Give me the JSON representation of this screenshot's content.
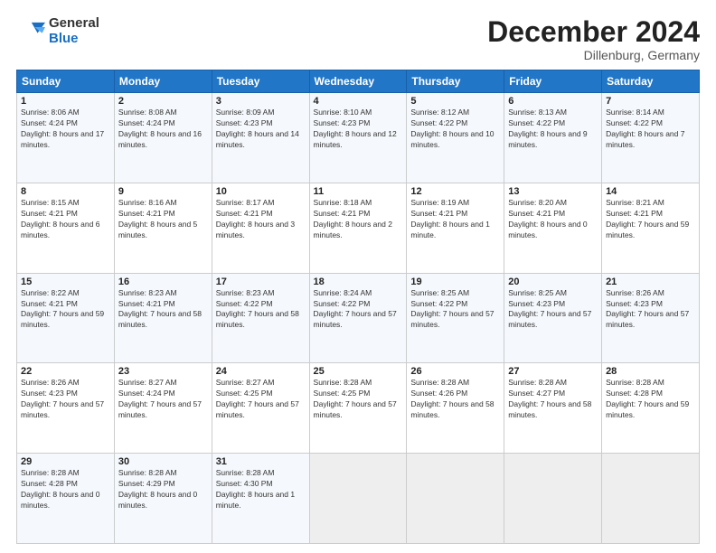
{
  "logo": {
    "general": "General",
    "blue": "Blue"
  },
  "header": {
    "month": "December 2024",
    "location": "Dillenburg, Germany"
  },
  "weekdays": [
    "Sunday",
    "Monday",
    "Tuesday",
    "Wednesday",
    "Thursday",
    "Friday",
    "Saturday"
  ],
  "weeks": [
    [
      {
        "day": "1",
        "sunrise": "Sunrise: 8:06 AM",
        "sunset": "Sunset: 4:24 PM",
        "daylight": "Daylight: 8 hours and 17 minutes."
      },
      {
        "day": "2",
        "sunrise": "Sunrise: 8:08 AM",
        "sunset": "Sunset: 4:24 PM",
        "daylight": "Daylight: 8 hours and 16 minutes."
      },
      {
        "day": "3",
        "sunrise": "Sunrise: 8:09 AM",
        "sunset": "Sunset: 4:23 PM",
        "daylight": "Daylight: 8 hours and 14 minutes."
      },
      {
        "day": "4",
        "sunrise": "Sunrise: 8:10 AM",
        "sunset": "Sunset: 4:23 PM",
        "daylight": "Daylight: 8 hours and 12 minutes."
      },
      {
        "day": "5",
        "sunrise": "Sunrise: 8:12 AM",
        "sunset": "Sunset: 4:22 PM",
        "daylight": "Daylight: 8 hours and 10 minutes."
      },
      {
        "day": "6",
        "sunrise": "Sunrise: 8:13 AM",
        "sunset": "Sunset: 4:22 PM",
        "daylight": "Daylight: 8 hours and 9 minutes."
      },
      {
        "day": "7",
        "sunrise": "Sunrise: 8:14 AM",
        "sunset": "Sunset: 4:22 PM",
        "daylight": "Daylight: 8 hours and 7 minutes."
      }
    ],
    [
      {
        "day": "8",
        "sunrise": "Sunrise: 8:15 AM",
        "sunset": "Sunset: 4:21 PM",
        "daylight": "Daylight: 8 hours and 6 minutes."
      },
      {
        "day": "9",
        "sunrise": "Sunrise: 8:16 AM",
        "sunset": "Sunset: 4:21 PM",
        "daylight": "Daylight: 8 hours and 5 minutes."
      },
      {
        "day": "10",
        "sunrise": "Sunrise: 8:17 AM",
        "sunset": "Sunset: 4:21 PM",
        "daylight": "Daylight: 8 hours and 3 minutes."
      },
      {
        "day": "11",
        "sunrise": "Sunrise: 8:18 AM",
        "sunset": "Sunset: 4:21 PM",
        "daylight": "Daylight: 8 hours and 2 minutes."
      },
      {
        "day": "12",
        "sunrise": "Sunrise: 8:19 AM",
        "sunset": "Sunset: 4:21 PM",
        "daylight": "Daylight: 8 hours and 1 minute."
      },
      {
        "day": "13",
        "sunrise": "Sunrise: 8:20 AM",
        "sunset": "Sunset: 4:21 PM",
        "daylight": "Daylight: 8 hours and 0 minutes."
      },
      {
        "day": "14",
        "sunrise": "Sunrise: 8:21 AM",
        "sunset": "Sunset: 4:21 PM",
        "daylight": "Daylight: 7 hours and 59 minutes."
      }
    ],
    [
      {
        "day": "15",
        "sunrise": "Sunrise: 8:22 AM",
        "sunset": "Sunset: 4:21 PM",
        "daylight": "Daylight: 7 hours and 59 minutes."
      },
      {
        "day": "16",
        "sunrise": "Sunrise: 8:23 AM",
        "sunset": "Sunset: 4:21 PM",
        "daylight": "Daylight: 7 hours and 58 minutes."
      },
      {
        "day": "17",
        "sunrise": "Sunrise: 8:23 AM",
        "sunset": "Sunset: 4:22 PM",
        "daylight": "Daylight: 7 hours and 58 minutes."
      },
      {
        "day": "18",
        "sunrise": "Sunrise: 8:24 AM",
        "sunset": "Sunset: 4:22 PM",
        "daylight": "Daylight: 7 hours and 57 minutes."
      },
      {
        "day": "19",
        "sunrise": "Sunrise: 8:25 AM",
        "sunset": "Sunset: 4:22 PM",
        "daylight": "Daylight: 7 hours and 57 minutes."
      },
      {
        "day": "20",
        "sunrise": "Sunrise: 8:25 AM",
        "sunset": "Sunset: 4:23 PM",
        "daylight": "Daylight: 7 hours and 57 minutes."
      },
      {
        "day": "21",
        "sunrise": "Sunrise: 8:26 AM",
        "sunset": "Sunset: 4:23 PM",
        "daylight": "Daylight: 7 hours and 57 minutes."
      }
    ],
    [
      {
        "day": "22",
        "sunrise": "Sunrise: 8:26 AM",
        "sunset": "Sunset: 4:23 PM",
        "daylight": "Daylight: 7 hours and 57 minutes."
      },
      {
        "day": "23",
        "sunrise": "Sunrise: 8:27 AM",
        "sunset": "Sunset: 4:24 PM",
        "daylight": "Daylight: 7 hours and 57 minutes."
      },
      {
        "day": "24",
        "sunrise": "Sunrise: 8:27 AM",
        "sunset": "Sunset: 4:25 PM",
        "daylight": "Daylight: 7 hours and 57 minutes."
      },
      {
        "day": "25",
        "sunrise": "Sunrise: 8:28 AM",
        "sunset": "Sunset: 4:25 PM",
        "daylight": "Daylight: 7 hours and 57 minutes."
      },
      {
        "day": "26",
        "sunrise": "Sunrise: 8:28 AM",
        "sunset": "Sunset: 4:26 PM",
        "daylight": "Daylight: 7 hours and 58 minutes."
      },
      {
        "day": "27",
        "sunrise": "Sunrise: 8:28 AM",
        "sunset": "Sunset: 4:27 PM",
        "daylight": "Daylight: 7 hours and 58 minutes."
      },
      {
        "day": "28",
        "sunrise": "Sunrise: 8:28 AM",
        "sunset": "Sunset: 4:28 PM",
        "daylight": "Daylight: 7 hours and 59 minutes."
      }
    ],
    [
      {
        "day": "29",
        "sunrise": "Sunrise: 8:28 AM",
        "sunset": "Sunset: 4:28 PM",
        "daylight": "Daylight: 8 hours and 0 minutes."
      },
      {
        "day": "30",
        "sunrise": "Sunrise: 8:28 AM",
        "sunset": "Sunset: 4:29 PM",
        "daylight": "Daylight: 8 hours and 0 minutes."
      },
      {
        "day": "31",
        "sunrise": "Sunrise: 8:28 AM",
        "sunset": "Sunset: 4:30 PM",
        "daylight": "Daylight: 8 hours and 1 minute."
      },
      null,
      null,
      null,
      null
    ]
  ]
}
